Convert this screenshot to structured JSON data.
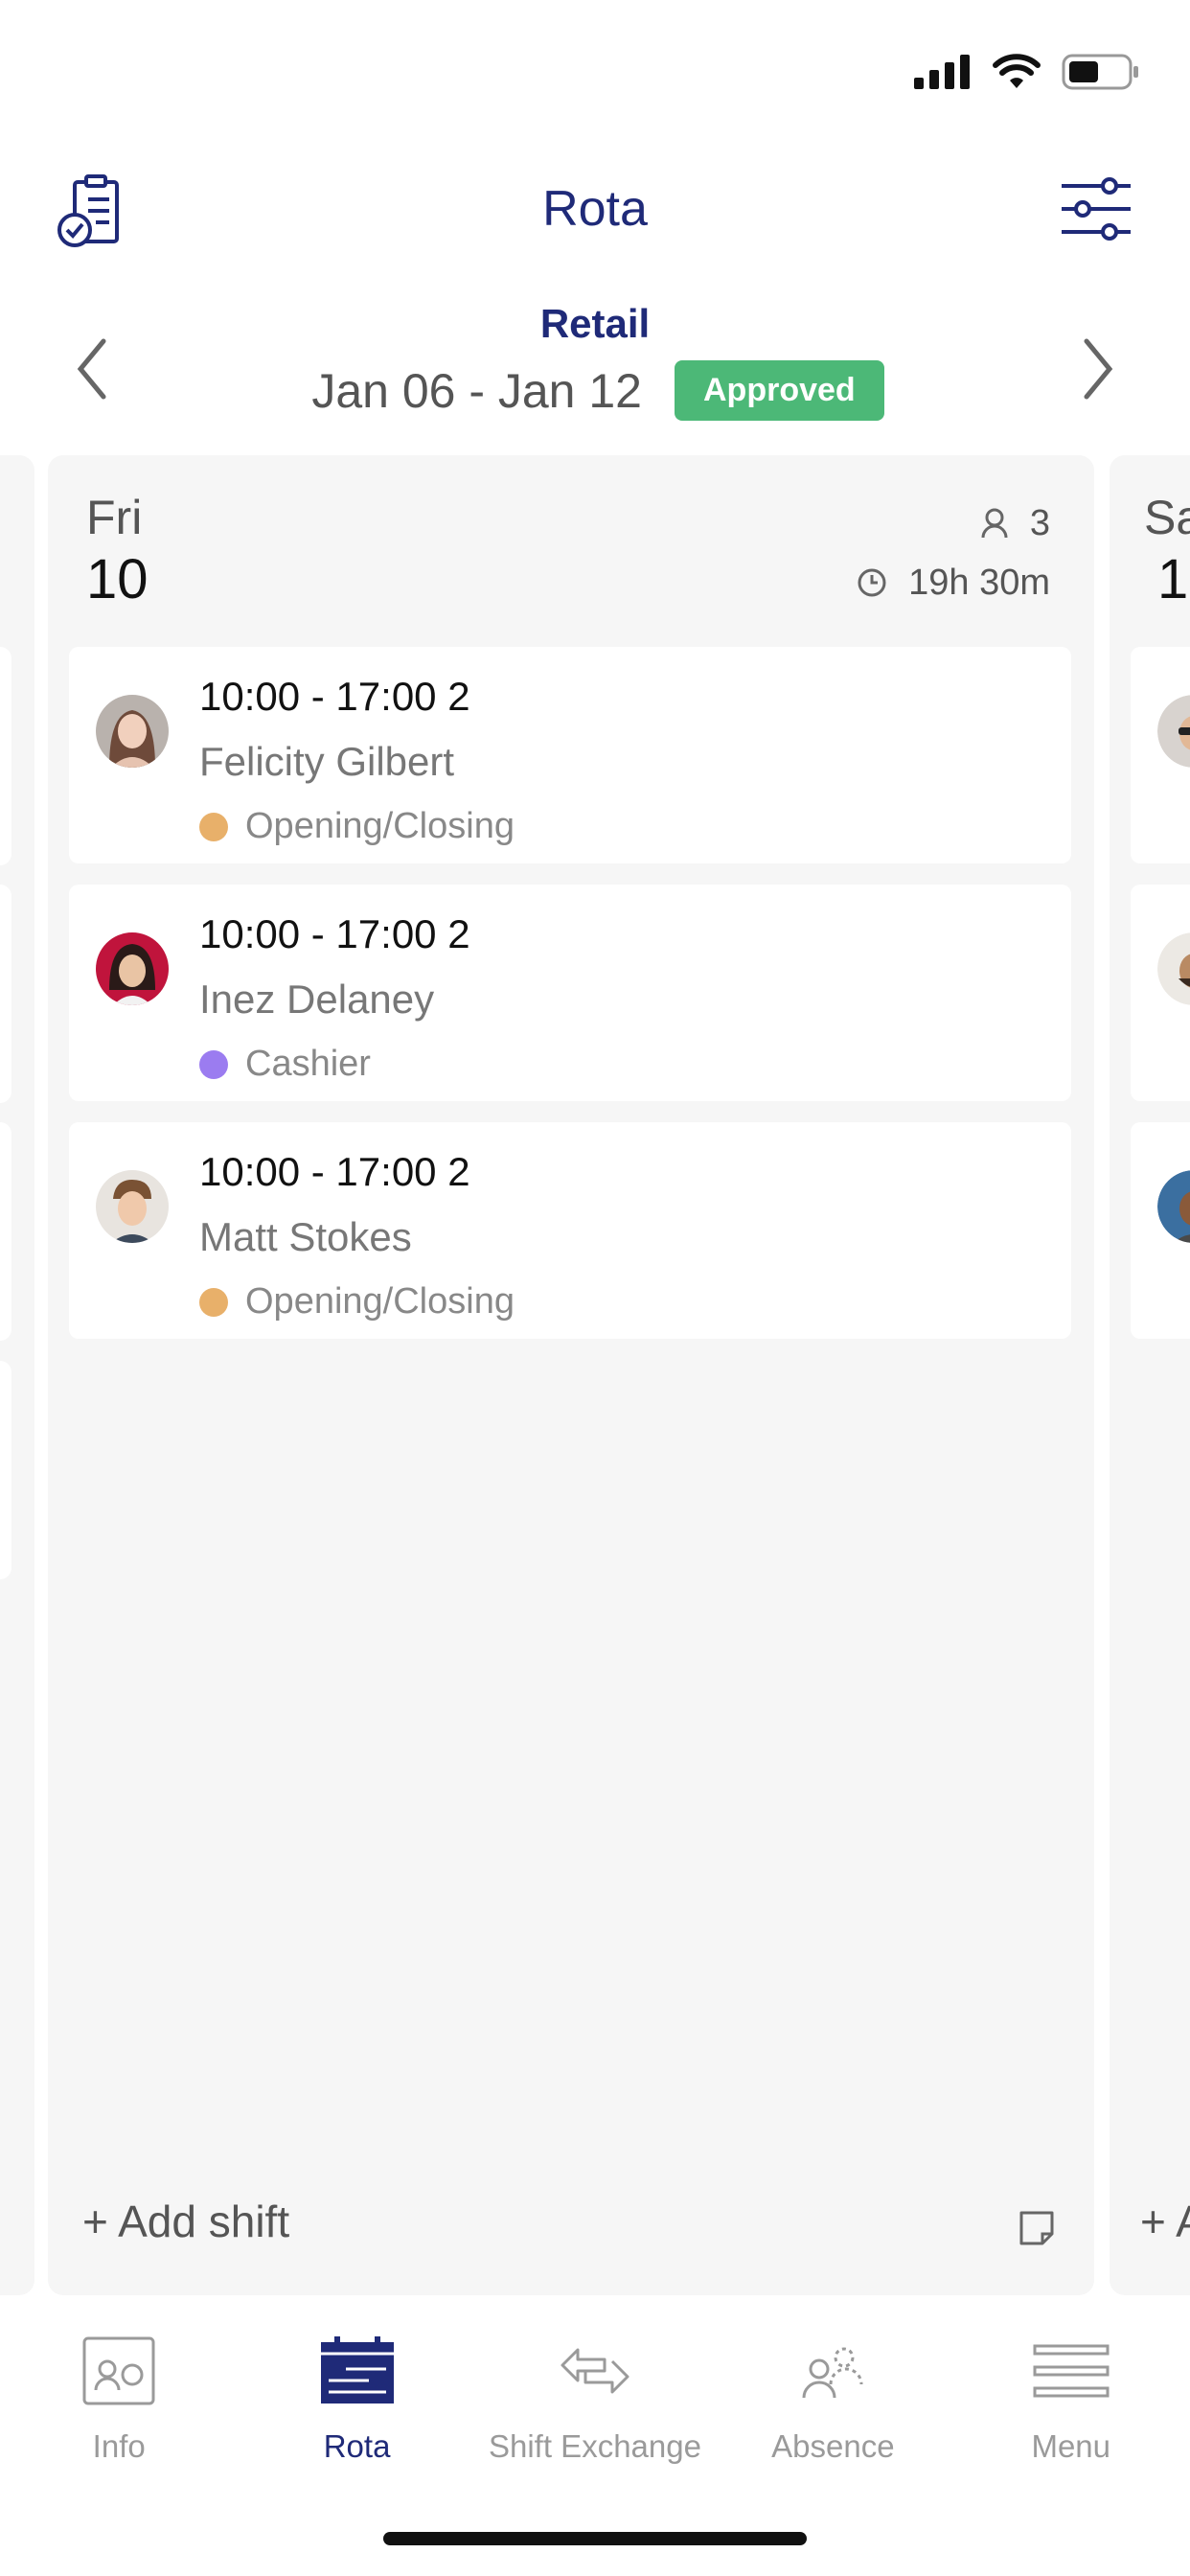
{
  "header": {
    "title": "Rota"
  },
  "week": {
    "location": "Retail",
    "range": "Jan 06 - Jan 12",
    "status": "Approved"
  },
  "day": {
    "name": "Fri",
    "number": "10",
    "staff_count": "3",
    "total_hours": "19h 30m",
    "shifts": [
      {
        "time": "10:00 - 17:00  2",
        "name": "Felicity Gilbert",
        "role": "Opening/Closing",
        "role_color": "#e8b06a"
      },
      {
        "time": "10:00 - 17:00  2",
        "name": "Inez Delaney",
        "role": "Cashier",
        "role_color": "#9b7cf0"
      },
      {
        "time": "10:00 - 17:00  2",
        "name": "Matt Stokes",
        "role": "Opening/Closing",
        "role_color": "#e8b06a"
      }
    ],
    "add_label": "+ Add shift"
  },
  "next_day": {
    "name_partial": "Sa",
    "number_partial": "1",
    "add_partial": "+ A"
  },
  "tabs": [
    {
      "label": "Info",
      "icon": "contact-card-icon"
    },
    {
      "label": "Rota",
      "icon": "rota-icon"
    },
    {
      "label": "Shift Exchange",
      "icon": "exchange-arrows-icon"
    },
    {
      "label": "Absence",
      "icon": "absence-people-icon"
    },
    {
      "label": "Menu",
      "icon": "menu-lines-icon"
    }
  ],
  "colors": {
    "brand": "#1f2a78",
    "approved": "#4cb877"
  }
}
